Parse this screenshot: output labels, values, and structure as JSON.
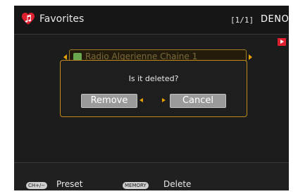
{
  "header": {
    "title": "Favorites",
    "page_indicator": "[1/1]",
    "brand": "DENON"
  },
  "list": {
    "selected_station": "Radio Algerienne Chaine 1"
  },
  "dialog": {
    "prompt": "Is it deleted?",
    "remove_label": "Remove",
    "cancel_label": "Cancel"
  },
  "footer": {
    "ch_key": "CH+/−",
    "preset_label": "Preset",
    "memory_key": "MEMORY",
    "delete_label": "Delete"
  },
  "colors": {
    "accent": "#e8a000",
    "heart": "#e0202f",
    "button": "#9a9a9a"
  }
}
